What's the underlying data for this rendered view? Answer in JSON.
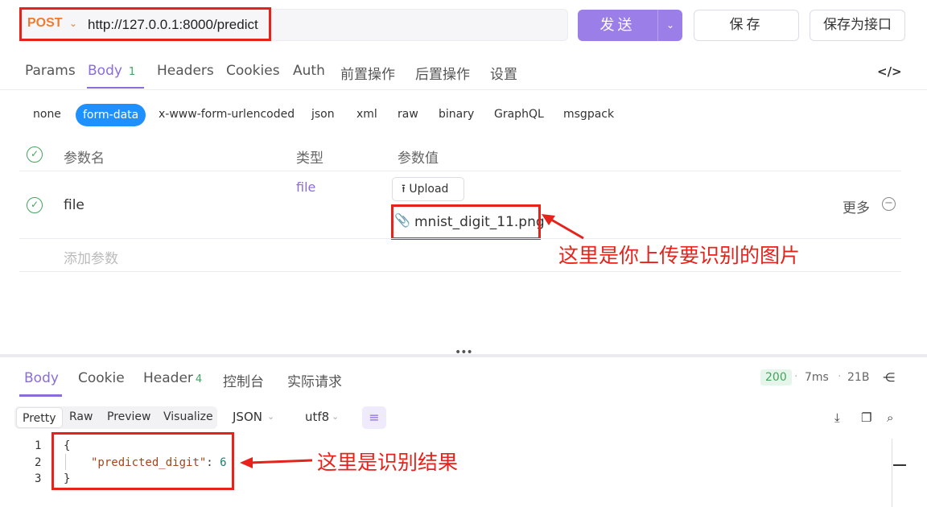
{
  "request": {
    "method": "POST",
    "url": "http://127.0.0.1:8000/predict",
    "send_label": "发送",
    "save_label": "保存",
    "save_as_api_label": "保存为接口"
  },
  "request_tabs": [
    {
      "label": "Params"
    },
    {
      "label": "Body",
      "badge": "1",
      "active": true
    },
    {
      "label": "Headers"
    },
    {
      "label": "Cookies"
    },
    {
      "label": "Auth"
    },
    {
      "label": "前置操作"
    },
    {
      "label": "后置操作"
    },
    {
      "label": "设置"
    }
  ],
  "body_types": [
    "none",
    "form-data",
    "x-www-form-urlencoded",
    "json",
    "xml",
    "raw",
    "binary",
    "GraphQL",
    "msgpack"
  ],
  "params_table": {
    "headers": [
      "参数名",
      "类型",
      "参数值"
    ],
    "rows": [
      {
        "name": "file",
        "type": "file",
        "upload_label": "Upload",
        "file": "mnist_digit_11.png",
        "more_label": "更多"
      }
    ],
    "add_placeholder": "添加参数"
  },
  "annotations": {
    "upload_note": "这里是你上传要识别的图片",
    "result_note": "这里是识别结果"
  },
  "response": {
    "tabs": [
      {
        "label": "Body",
        "active": true
      },
      {
        "label": "Cookie"
      },
      {
        "label": "Header",
        "badge": "4"
      },
      {
        "label": "控制台"
      },
      {
        "label": "实际请求"
      }
    ],
    "status": "200",
    "time": "7ms",
    "size": "21B",
    "formats": [
      "Pretty",
      "Raw",
      "Preview",
      "Visualize"
    ],
    "content_type": "JSON",
    "encoding": "utf8",
    "code_lines": {
      "open": "{",
      "key": "\"predicted_digit\"",
      "colon": ": ",
      "value": "6",
      "close": "}"
    },
    "line_numbers": [
      "1",
      "2",
      "3"
    ]
  },
  "colors": {
    "accent": "#8b6cdb",
    "method": "#f07b2f",
    "annotation": "#e5231b",
    "success": "#42a55d",
    "form_data": "#1e90ff"
  },
  "icons": [
    "chevron-down-icon",
    "code-icon",
    "check-circle-icon",
    "upload-icon",
    "paperclip-icon",
    "minus-circle-icon",
    "share-icon",
    "wrap-lines-icon",
    "download-icon",
    "copy-icon",
    "search-icon",
    "arrow-icon"
  ]
}
